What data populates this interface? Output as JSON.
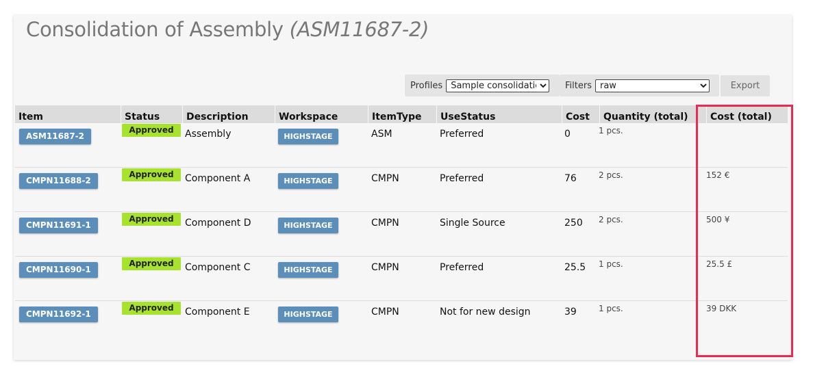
{
  "page": {
    "title": "Consolidation of Assembly",
    "title_id": "(ASM11687-2)"
  },
  "toolbar": {
    "profiles_label": "Profiles",
    "profiles_selected": "Sample consolidation",
    "filters_label": "Filters",
    "filters_selected": "raw",
    "export_label": "Export"
  },
  "table": {
    "columns": [
      "Item",
      "Status",
      "Description",
      "Workspace",
      "ItemType",
      "UseStatus",
      "Cost",
      "Quantity (total)",
      "Cost (total)"
    ],
    "rows": [
      {
        "item": "ASM11687-2",
        "status": "Approved",
        "description": "Assembly",
        "workspace": "HIGHSTAGE",
        "itemtype": "ASM",
        "usestatus": "Preferred",
        "cost": "0",
        "quantity": "1 pcs.",
        "cost_total": ""
      },
      {
        "item": "CMPN11688-2",
        "status": "Approved",
        "description": "Component A",
        "workspace": "HIGHSTAGE",
        "itemtype": "CMPN",
        "usestatus": "Preferred",
        "cost": "76",
        "quantity": "2 pcs.",
        "cost_total": "152 €"
      },
      {
        "item": "CMPN11691-1",
        "status": "Approved",
        "description": "Component D",
        "workspace": "HIGHSTAGE",
        "itemtype": "CMPN",
        "usestatus": "Single Source",
        "cost": "250",
        "quantity": "2 pcs.",
        "cost_total": "500 ¥"
      },
      {
        "item": "CMPN11690-1",
        "status": "Approved",
        "description": "Component C",
        "workspace": "HIGHSTAGE",
        "itemtype": "CMPN",
        "usestatus": "Preferred",
        "cost": "25.5",
        "quantity": "1 pcs.",
        "cost_total": "25.5 £"
      },
      {
        "item": "CMPN11692-1",
        "status": "Approved",
        "description": "Component E",
        "workspace": "HIGHSTAGE",
        "itemtype": "CMPN",
        "usestatus": "Not for new design",
        "cost": "39",
        "quantity": "1 pcs.",
        "cost_total": "39 DKK"
      }
    ]
  },
  "colors": {
    "item_button": "#5b8fba",
    "approved_badge": "#a6e22e",
    "highlight_box": "#ec2a50"
  }
}
